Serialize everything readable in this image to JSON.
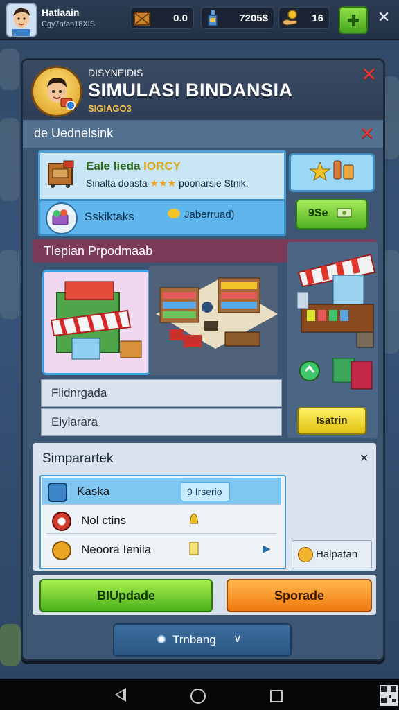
{
  "hud": {
    "player_name": "Hatlaain",
    "player_sub": "Cgy7n/an18XIS",
    "resources": [
      {
        "icon": "crate-icon",
        "value": "0.0"
      },
      {
        "icon": "bottle-icon",
        "value": "7205$"
      },
      {
        "icon": "coin-hand-icon",
        "value": "16"
      }
    ],
    "add_icon": "plus-icon",
    "close_icon": "close-icon"
  },
  "panel": {
    "kicker": "DISYNEIDIS",
    "title": "SIMULASI BINDANSIA",
    "subtitle": "SIGIAGO3",
    "section1": {
      "title": "de Uednelsink",
      "info_title_a": "Eale lieda",
      "info_title_b": "IORCY",
      "info_text_a": "Sinalta doasta",
      "info_stars": "★★★",
      "info_text_b": "poonarsie Stnik.",
      "tip_label": "Sskiktaks",
      "tip_value": "Jaberruad)",
      "side_button": "9Se"
    },
    "section2": {
      "title": "Tlepian Prpodmaab",
      "option_1": "Flidnrgada",
      "option_2": "Eiylarara",
      "store_button": "Isatrin"
    },
    "section3": {
      "title": "Simparartek",
      "pin": "✕",
      "items": [
        {
          "label": "Kaska",
          "tag": "9 Irserio",
          "icon": "gem-icon",
          "color": "#3c86c8"
        },
        {
          "label": "Nol ctins",
          "icon": "red-orb-icon",
          "color": "#d33b2b"
        },
        {
          "label": "Neoora Ienila",
          "icon": "gold-coin-icon",
          "color": "#e7a522"
        }
      ],
      "side_button": "Halpatan"
    },
    "buttons": {
      "primary": "BIUpdade",
      "secondary": "Sporade",
      "footer": "Trnbang",
      "footer_chevron": "∨"
    }
  },
  "colors": {
    "green": "#4cb21c",
    "orange": "#f07a10",
    "accent_blue": "#3fa1e6",
    "title_band": "#7b3a58"
  }
}
